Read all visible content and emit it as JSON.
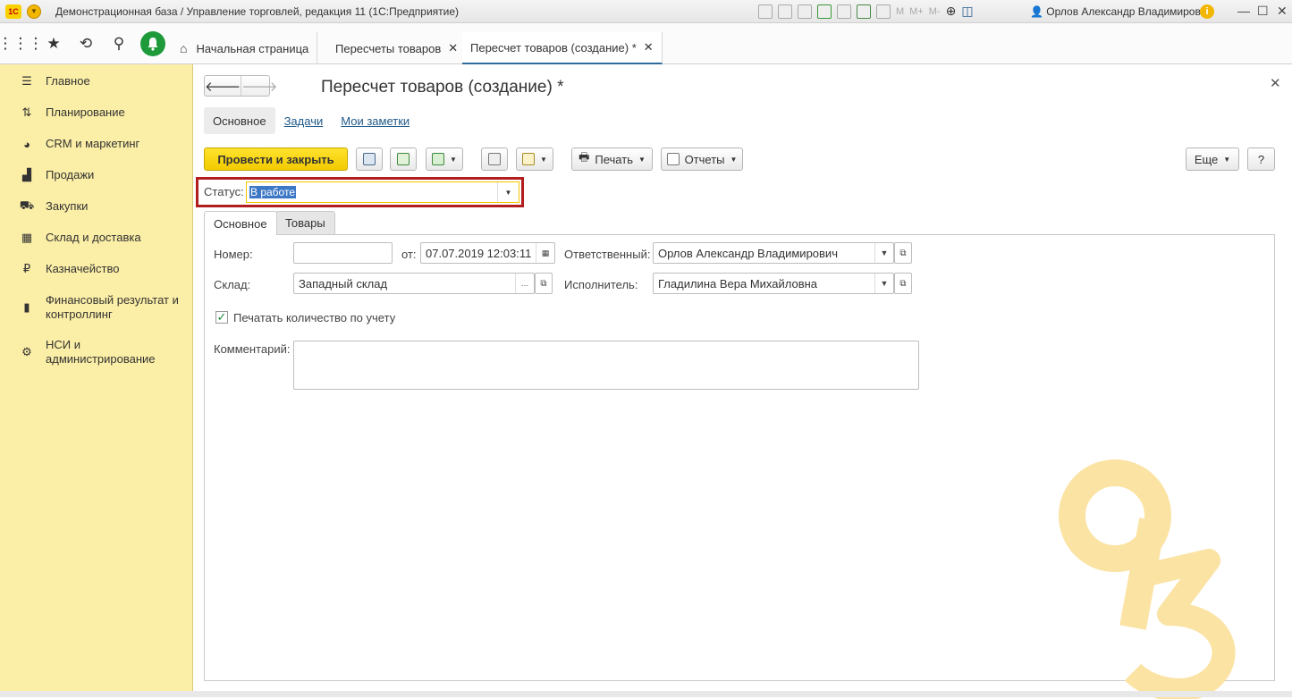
{
  "titlebar": {
    "title": "Демонстрационная база / Управление торговлей, редакция 11  (1С:Предприятие)",
    "logo": "1С",
    "mem_buttons": [
      "M",
      "M+",
      "M-"
    ],
    "user": "Орлов Александр Владимирович",
    "icons": [
      "save-icon",
      "print-icon",
      "preview-icon",
      "download-icon",
      "copy-icon",
      "calculator-icon",
      "calendar-icon",
      "zoom-icon",
      "panel-icon",
      "info-icon",
      "minimize-icon",
      "maximize-icon",
      "close-icon"
    ]
  },
  "navbar": {
    "icons": [
      "apps-grid-icon",
      "star-icon",
      "history-icon",
      "search-icon",
      "bell-icon",
      "home-icon"
    ],
    "tabs": [
      {
        "label": "Начальная страница"
      },
      {
        "label": "Пересчеты товаров"
      },
      {
        "label": "Пересчет товаров (создание) *"
      }
    ]
  },
  "sidebar": {
    "items": [
      {
        "label": "Главное",
        "icon": "menu-icon"
      },
      {
        "label": "Планирование",
        "icon": "planning-icon"
      },
      {
        "label": "CRM и маркетинг",
        "icon": "crm-icon"
      },
      {
        "label": "Продажи",
        "icon": "sales-bag-icon"
      },
      {
        "label": "Закупки",
        "icon": "cart-icon"
      },
      {
        "label": "Склад и доставка",
        "icon": "warehouse-icon"
      },
      {
        "label": "Казначейство",
        "icon": "ruble-icon"
      },
      {
        "label": "Финансовый результат и контроллинг",
        "icon": "chart-icon"
      },
      {
        "label": "НСИ и администрирование",
        "icon": "gear-icon"
      }
    ]
  },
  "form": {
    "title": "Пересчет товаров (создание) *",
    "tabs": [
      "Основное",
      "Задачи",
      "Мои заметки"
    ],
    "toolbar": {
      "post_close": "Провести и закрыть",
      "print": "Печать",
      "reports": "Отчеты",
      "more": "Еще",
      "help": "?"
    },
    "status": {
      "label": "Статус:",
      "value": "В работе"
    },
    "subtabs": [
      "Основное",
      "Товары"
    ],
    "fields": {
      "number_label": "Номер:",
      "number_value": "",
      "date_label": "от:",
      "date_value": "07.07.2019 12:03:11",
      "responsible_label": "Ответственный:",
      "responsible_value": "Орлов Александр Владимирович",
      "warehouse_label": "Склад:",
      "warehouse_value": "Западный склад",
      "executor_label": "Исполнитель:",
      "executor_value": "Гладилина Вера Михайловна",
      "print_qty_label": "Печатать количество по учету",
      "print_qty_checked": true,
      "comment_label": "Комментарий:",
      "comment_value": ""
    }
  },
  "colors": {
    "sidebar_bg": "#fbeea6",
    "primary_button": "#f5d000",
    "status_highlight": "#b21e1e",
    "active_tab_underline": "#2c6d9c"
  }
}
